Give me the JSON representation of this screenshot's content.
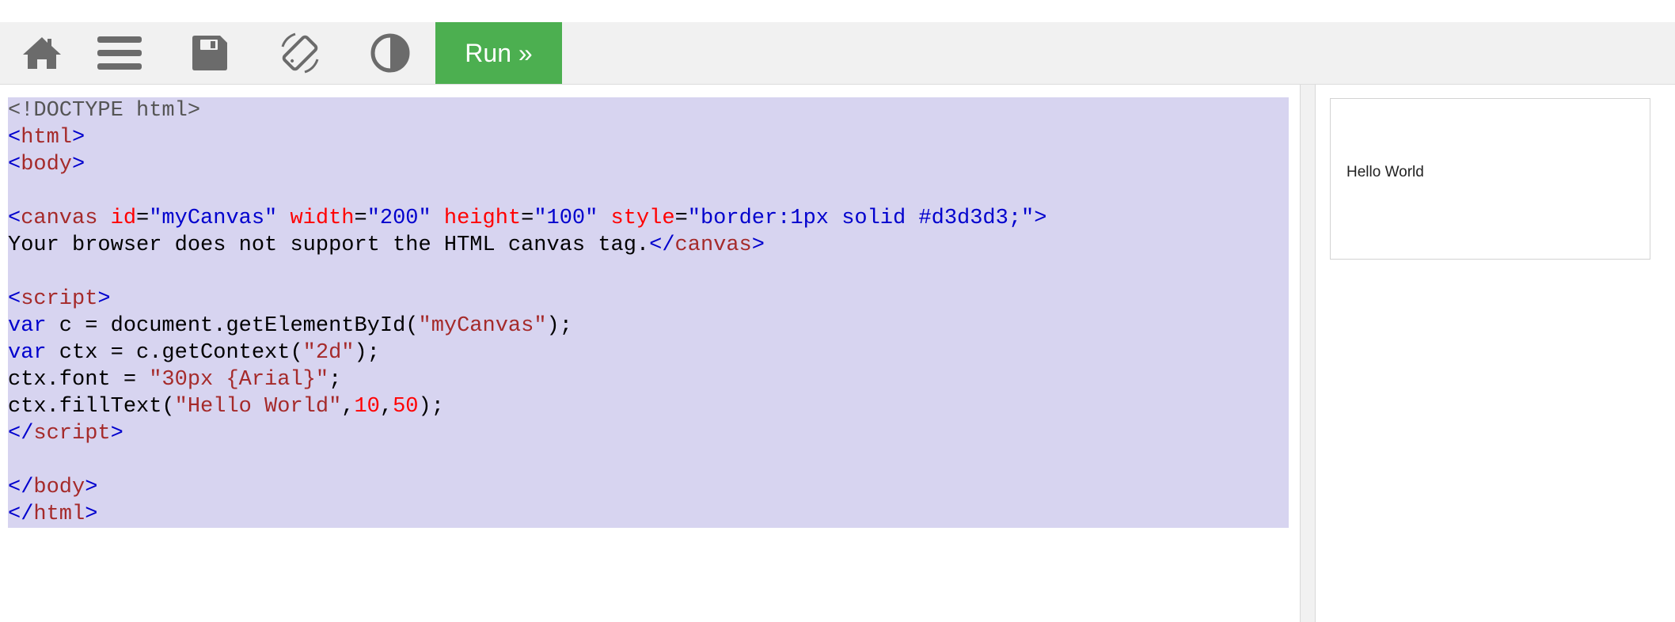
{
  "toolbar": {
    "buttons": [
      {
        "icon": "home-icon"
      },
      {
        "icon": "menu-icon"
      },
      {
        "icon": "save-icon"
      },
      {
        "icon": "rotate-icon"
      },
      {
        "icon": "contrast-icon"
      }
    ],
    "run_label": "Run »",
    "run_color": "#4caf50"
  },
  "editor": {
    "selection_color": "#d7d4f0",
    "lines": [
      [
        {
          "t": "doctype",
          "v": "<!DOCTYPE html>"
        }
      ],
      [
        {
          "t": "bracket",
          "v": "<"
        },
        {
          "t": "tag",
          "v": "html"
        },
        {
          "t": "bracket",
          "v": ">"
        }
      ],
      [
        {
          "t": "bracket",
          "v": "<"
        },
        {
          "t": "tag",
          "v": "body"
        },
        {
          "t": "bracket",
          "v": ">"
        }
      ],
      [],
      [
        {
          "t": "bracket",
          "v": "<"
        },
        {
          "t": "tag",
          "v": "canvas"
        },
        {
          "t": "plain",
          "v": " "
        },
        {
          "t": "attr",
          "v": "id"
        },
        {
          "t": "plain",
          "v": "="
        },
        {
          "t": "attrval",
          "v": "\"myCanvas\""
        },
        {
          "t": "plain",
          "v": " "
        },
        {
          "t": "attr",
          "v": "width"
        },
        {
          "t": "plain",
          "v": "="
        },
        {
          "t": "attrval",
          "v": "\"200\""
        },
        {
          "t": "plain",
          "v": " "
        },
        {
          "t": "attr",
          "v": "height"
        },
        {
          "t": "plain",
          "v": "="
        },
        {
          "t": "attrval",
          "v": "\"100\""
        },
        {
          "t": "plain",
          "v": " "
        },
        {
          "t": "attr",
          "v": "style"
        },
        {
          "t": "plain",
          "v": "="
        },
        {
          "t": "attrval",
          "v": "\"border:1px solid #d3d3d3;\""
        },
        {
          "t": "bracket",
          "v": ">"
        }
      ],
      [
        {
          "t": "plain",
          "v": "Your browser does not support the HTML canvas tag."
        },
        {
          "t": "bracket",
          "v": "</"
        },
        {
          "t": "tag",
          "v": "canvas"
        },
        {
          "t": "bracket",
          "v": ">"
        }
      ],
      [],
      [
        {
          "t": "bracket",
          "v": "<"
        },
        {
          "t": "tag",
          "v": "script"
        },
        {
          "t": "bracket",
          "v": ">"
        }
      ],
      [
        {
          "t": "keyword",
          "v": "var"
        },
        {
          "t": "plain",
          "v": " c = document.getElementById("
        },
        {
          "t": "string",
          "v": "\"myCanvas\""
        },
        {
          "t": "plain",
          "v": ");"
        }
      ],
      [
        {
          "t": "keyword",
          "v": "var"
        },
        {
          "t": "plain",
          "v": " ctx = c.getContext("
        },
        {
          "t": "string",
          "v": "\"2d\""
        },
        {
          "t": "plain",
          "v": ");"
        }
      ],
      [
        {
          "t": "plain",
          "v": "ctx.font = "
        },
        {
          "t": "string",
          "v": "\"30px {Arial}\""
        },
        {
          "t": "plain",
          "v": ";"
        }
      ],
      [
        {
          "t": "plain",
          "v": "ctx.fillText("
        },
        {
          "t": "string",
          "v": "\"Hello World\""
        },
        {
          "t": "plain",
          "v": ","
        },
        {
          "t": "number",
          "v": "10"
        },
        {
          "t": "plain",
          "v": ","
        },
        {
          "t": "number",
          "v": "50"
        },
        {
          "t": "plain",
          "v": ");"
        }
      ],
      [
        {
          "t": "bracket",
          "v": "</"
        },
        {
          "t": "tag",
          "v": "script"
        },
        {
          "t": "bracket",
          "v": ">"
        }
      ],
      [],
      [
        {
          "t": "bracket",
          "v": "</"
        },
        {
          "t": "tag",
          "v": "body"
        },
        {
          "t": "bracket",
          "v": ">"
        }
      ],
      [
        {
          "t": "bracket",
          "v": "</"
        },
        {
          "t": "tag",
          "v": "html"
        },
        {
          "t": "bracket",
          "v": ">"
        }
      ]
    ]
  },
  "result": {
    "canvas_text": "Hello World",
    "canvas_border_color": "#d3d3d3"
  }
}
